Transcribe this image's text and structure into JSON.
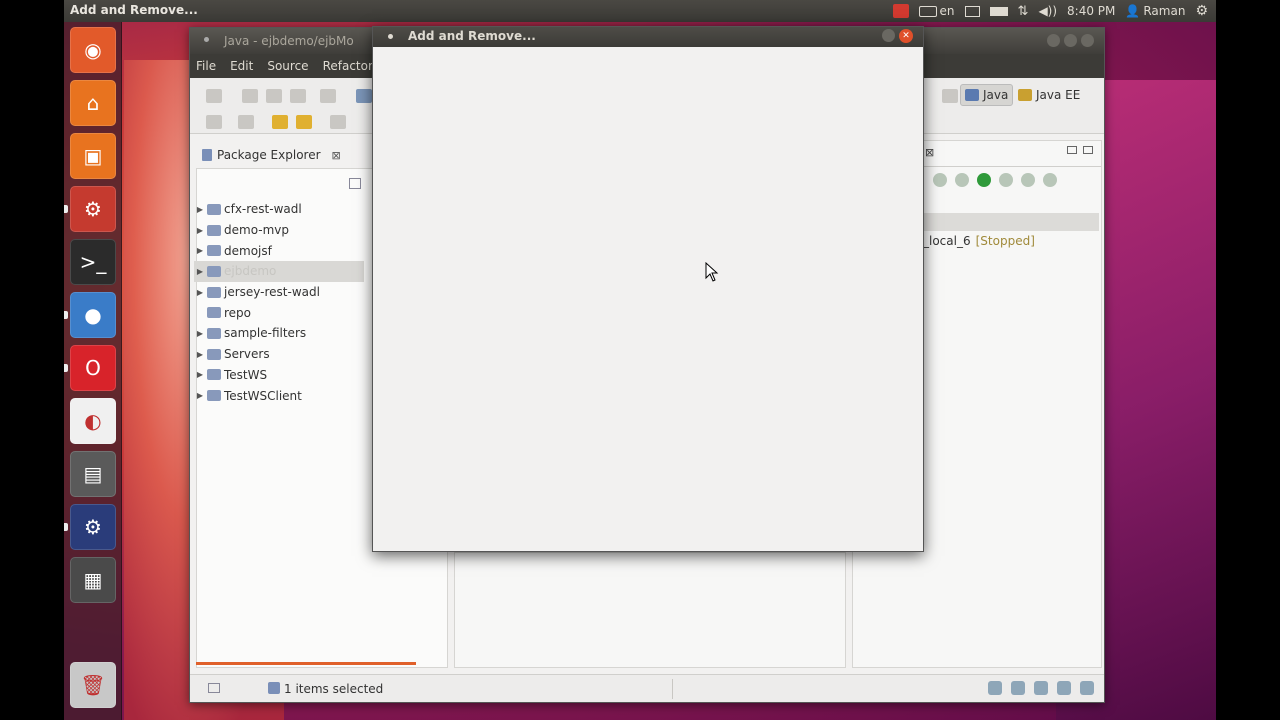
{
  "top_panel": {
    "app_title": "Add and Remove...",
    "keyboard_layout": "en",
    "clock": "8:40 PM",
    "user": "Raman"
  },
  "launcher": {
    "items": [
      {
        "name": "dash-icon",
        "color": "#e25a2a"
      },
      {
        "name": "home-folder-icon",
        "color": "#e8731f"
      },
      {
        "name": "package-manager-icon",
        "color": "#e8731f"
      },
      {
        "name": "system-settings-icon",
        "color": "#c53a2f"
      },
      {
        "name": "terminal-icon",
        "color": "#2b2b2b"
      },
      {
        "name": "chrome-icon",
        "color": "#3a7cc8"
      },
      {
        "name": "opera-icon",
        "color": "#d8232a"
      },
      {
        "name": "eclipse-icon",
        "color": "#f0f0f0"
      },
      {
        "name": "video-editor-icon",
        "color": "#5a5a5a"
      },
      {
        "name": "eclipse-jee-icon",
        "color": "#2a3c7a"
      },
      {
        "name": "workspace-switcher-icon",
        "color": "#4a4a4a"
      },
      {
        "name": "trash-icon",
        "color": "#c8c8c8"
      }
    ]
  },
  "eclipse_window": {
    "title": "Java - ejbdemo/ejbMo",
    "menu": [
      "File",
      "Edit",
      "Source",
      "Refactor"
    ],
    "perspectives": {
      "java": "Java",
      "java_ee": "Java EE"
    },
    "package_explorer": {
      "tab_label": "Package Explorer",
      "projects": [
        {
          "label": "cfx-rest-wadl",
          "faded": false,
          "selected": false
        },
        {
          "label": "demo-mvp",
          "faded": false,
          "selected": false
        },
        {
          "label": "demojsf",
          "faded": false,
          "selected": false
        },
        {
          "label": "ejbdemo",
          "faded": true,
          "selected": true
        },
        {
          "label": "jersey-rest-wadl",
          "faded": false,
          "selected": false
        },
        {
          "label": "repo",
          "faded": false,
          "selected": false
        },
        {
          "label": "sample-filters",
          "faded": false,
          "selected": false
        },
        {
          "label": "Servers",
          "faded": false,
          "selected": false
        },
        {
          "label": "TestWS",
          "faded": false,
          "selected": false
        },
        {
          "label": "TestWSClient",
          "faded": false,
          "selected": false
        }
      ]
    },
    "servers": {
      "server_name": "_local_6",
      "server_status": "[Stopped]"
    },
    "status_bar": {
      "selection": "1 items selected"
    }
  },
  "dialog": {
    "title": "Add and Remove..."
  }
}
